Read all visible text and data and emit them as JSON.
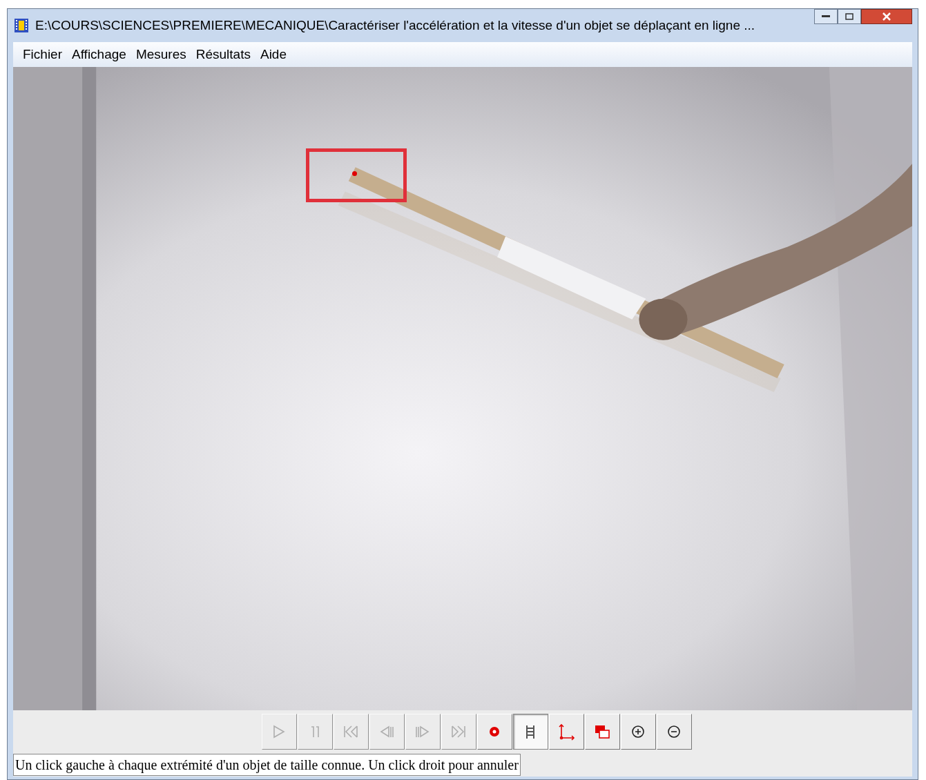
{
  "window": {
    "title": "E:\\COURS\\SCIENCES\\PREMIERE\\MECANIQUE\\Caractériser l'accélération et la vitesse d'un objet se déplaçant en ligne ..."
  },
  "menu": [
    "Fichier",
    "Affichage",
    "Mesures",
    "Résultats",
    "Aide"
  ],
  "video": {
    "kind": "picture",
    "selection_marker": true
  },
  "toolbar": [
    {
      "kind": "play",
      "disabled": true,
      "selected": false
    },
    {
      "kind": "pause",
      "disabled": true,
      "selected": false
    },
    {
      "kind": "first",
      "disabled": true,
      "selected": false
    },
    {
      "kind": "previous",
      "disabled": true,
      "selected": false
    },
    {
      "kind": "next",
      "disabled": true,
      "selected": false
    },
    {
      "kind": "last",
      "disabled": true,
      "selected": false
    },
    {
      "kind": "record",
      "disabled": false,
      "selected": false
    },
    {
      "kind": "scale",
      "disabled": false,
      "selected": true
    },
    {
      "kind": "axes",
      "disabled": false,
      "selected": false
    },
    {
      "kind": "windows",
      "disabled": false,
      "selected": false
    },
    {
      "kind": "zoom_in",
      "disabled": false,
      "selected": false
    },
    {
      "kind": "zoom_out",
      "disabled": false,
      "selected": false
    }
  ],
  "status_bar": "Un click gauche à chaque extrémité d'un objet de taille connue. Un click droit pour annuler"
}
